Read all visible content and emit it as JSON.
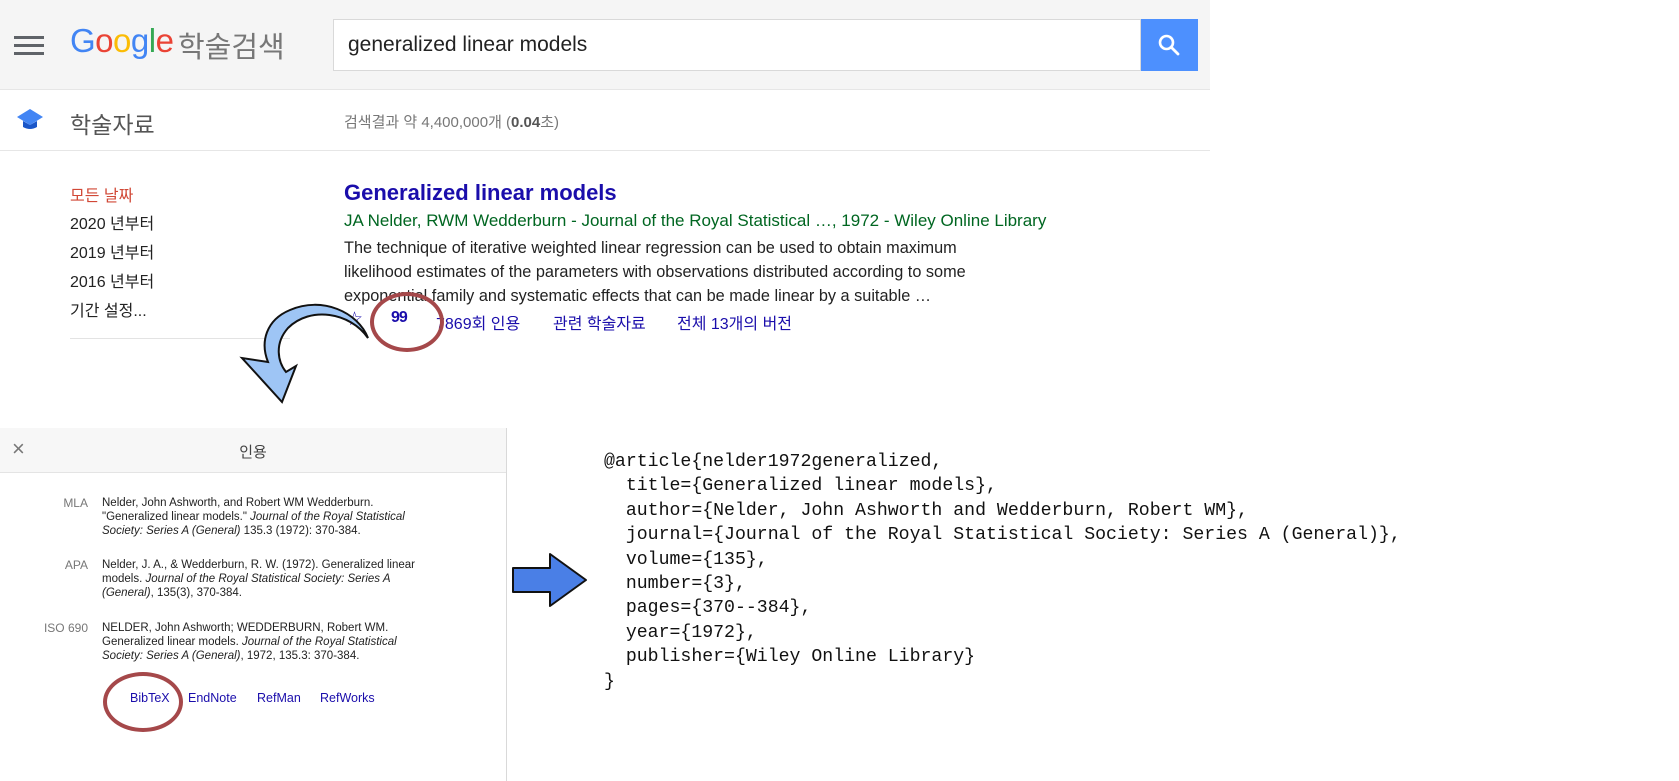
{
  "header": {
    "logo_text": [
      "G",
      "o",
      "o",
      "g",
      "l",
      "e"
    ],
    "logo_sub": "학술검색",
    "search_value": "generalized linear models"
  },
  "section": {
    "label": "학술자료",
    "stats_prefix": "검색결과 약 4,400,000개 (",
    "stats_time": "0.04",
    "stats_suffix": "초)"
  },
  "date_filters": [
    {
      "label": "모든 날짜",
      "active": true
    },
    {
      "label": "2020 년부터",
      "active": false
    },
    {
      "label": "2019 년부터",
      "active": false
    },
    {
      "label": "2016 년부터",
      "active": false
    },
    {
      "label": "기간 설정...",
      "active": false
    }
  ],
  "result": {
    "title": "Generalized linear models",
    "authors": "JA Nelder, RWM Wedderburn - Journal of the Royal Statistical …, 1972 - Wiley Online Library",
    "snippet": [
      "The technique of iterative weighted linear regression can be used to obtain maximum",
      "likelihood estimates of the parameters with observations distributed according to some",
      "exponential family and systematic effects that can be made linear by a suitable …"
    ],
    "star_icon": "☆",
    "cite_icon": "99",
    "cited_by": "7869회 인용",
    "related": "관련 학술자료",
    "versions": "전체 13개의 버전"
  },
  "dialog": {
    "title": "인용",
    "close": "×",
    "citations": [
      {
        "style": "MLA",
        "lines": [
          "Nelder, John Ashworth, and Robert WM Wedderburn.",
          "\"Generalized linear models.\" Journal of the Royal Statistical",
          "Society: Series A (General) 135.3 (1972): 370-384."
        ]
      },
      {
        "style": "APA",
        "lines": [
          "Nelder, J. A., & Wedderburn, R. W. (1972). Generalized linear",
          "models. Journal of the Royal Statistical Society: Series A",
          "(General), 135(3), 370-384."
        ]
      },
      {
        "style": "ISO 690",
        "lines": [
          "NELDER, John Ashworth; WEDDERBURN, Robert WM.",
          "Generalized linear models. Journal of the Royal Statistical",
          "Society: Series A (General), 1972, 135.3: 370-384."
        ]
      }
    ],
    "exports": [
      "BibTeX",
      "EndNote",
      "RefMan",
      "RefWorks"
    ]
  },
  "bibtex": [
    "@article{nelder1972generalized,",
    "  title={Generalized linear models},",
    "  author={Nelder, John Ashworth and Wedderburn, Robert WM},",
    "  journal={Journal of the Royal Statistical Society: Series A (General)},",
    "  volume={135},",
    "  number={3},",
    "  pages={370--384},",
    "  year={1972},",
    "  publisher={Wiley Online Library}",
    "}"
  ],
  "colors": {
    "link": "#1a0dab",
    "author_green": "#006621",
    "active_red": "#d14836",
    "highlight_circle": "#a5484a",
    "arrow_fill": "#9ec5f5"
  }
}
